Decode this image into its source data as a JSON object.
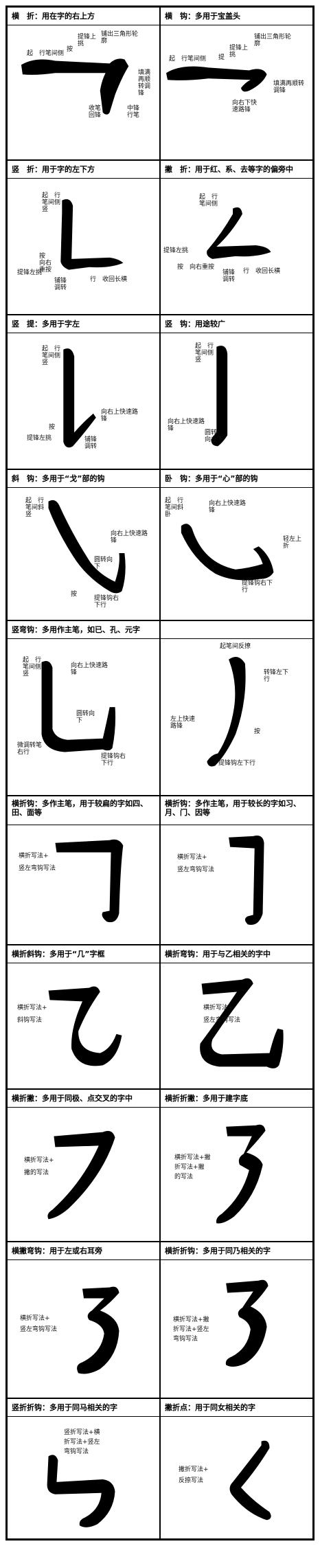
{
  "rows": [
    [
      {
        "header": "横　折：用在字的右上方",
        "notes": [
          "起　行笔间侧",
          "提锋上挑",
          "按",
          "铺出三角形轮廓",
          "填满再顺转调锋",
          "收笔回锋",
          "中锋行笔"
        ]
      },
      {
        "header": "横　钩：多用于宝盖头",
        "notes": [
          "起　行笔间侧",
          "提锋上挑",
          "提",
          "铺出三角形轮廓",
          "填满再顺转调锋",
          "向右下快速路锋"
        ]
      }
    ],
    [
      {
        "header": "竖　折：用于字的左下方",
        "notes": [
          "起　行笔间侧竖",
          "提锋左挑",
          "按　向右重按",
          "铺锋调转",
          "行　收回长横"
        ]
      },
      {
        "header": "撇　折：用于红、系、去等字的偏旁中",
        "notes": [
          "起　行笔间侧",
          "提锋左挑",
          "铺锋调转",
          "行　收回长横",
          "按　向右重按"
        ]
      }
    ],
    [
      {
        "header": "竖　提：多用于字左",
        "notes": [
          "起　行笔间侧竖",
          "按",
          "提锋左挑",
          "向右上快速路锋",
          "铺锋调转"
        ]
      },
      {
        "header": "竖　钩：用途较广",
        "notes": [
          "起　行笔间侧竖",
          "向右上快速路锋",
          "圆转　向左下"
        ]
      }
    ],
    [
      {
        "header": "斜　钩：多用于“戈”部的钩",
        "notes": [
          "起　行笔间斜竖",
          "向右上快速路锋",
          "圆转向下",
          "按",
          "提锋钩右下行"
        ]
      },
      {
        "header": "卧　钩：多用于“心”部的钩",
        "notes": [
          "起　行笔间斜卧",
          "向右上快速路锋",
          "提锋钩右下行",
          "轻左上折"
        ]
      }
    ],
    [
      {
        "header": "竖弯钩：多用作主笔，如已、孔、元字",
        "notes": [
          "起　行笔间侧竖",
          "向右上快速路锋",
          "圆转向下",
          "微调转笔右行",
          "提锋钩右下行"
        ]
      },
      {
        "header": "",
        "notes": [
          "起笔间反撩",
          "转锋左下行",
          "左上快速路锋",
          "按",
          "提锋钩左下行"
        ]
      }
    ],
    [
      {
        "header": "横折钩：多作主笔，用于较扁的字如四、田、面等",
        "notes": [
          "横折写法+",
          "竖左弯钩写法"
        ]
      },
      {
        "header": "横折钩：多作主笔，用于较长的字如习、月、门、因等",
        "notes": [
          "横折写法+",
          "竖左弯钩写法"
        ]
      }
    ],
    [
      {
        "header": "横折斜钩：多用于“几”字框",
        "notes": [
          "横折写法+",
          "斜钩写法"
        ]
      },
      {
        "header": "横折弯钩：用于与乙相关的字中",
        "notes": [
          "横折写法+",
          "竖左弯钩写法"
        ]
      }
    ],
    [
      {
        "header": "横折撇：多用于同极、点交叉的字中",
        "notes": [
          "横折写法+",
          "撇的写法"
        ]
      },
      {
        "header": "横折折撇：多用于建字底",
        "notes": [
          "横折写法+撇",
          "折写法+撇",
          "的写法"
        ]
      }
    ],
    [
      {
        "header": "横撇弯钩：用于左或右耳旁",
        "notes": [
          "横折写法+",
          "竖左弯钩写法"
        ]
      },
      {
        "header": "横折折钩：多用于同乃相关的字",
        "notes": [
          "横折写法+撇",
          "折写法+竖左",
          "弯钩写法"
        ]
      }
    ],
    [
      {
        "header": "竖折折钩：多用于同马相关的字",
        "notes": [
          "竖折写法+横",
          "折写法+竖左",
          "弯钩写法"
        ]
      },
      {
        "header": "撇折点：用于同女相关的字",
        "notes": [
          "撇折写法+",
          "反捺写法"
        ]
      }
    ]
  ]
}
